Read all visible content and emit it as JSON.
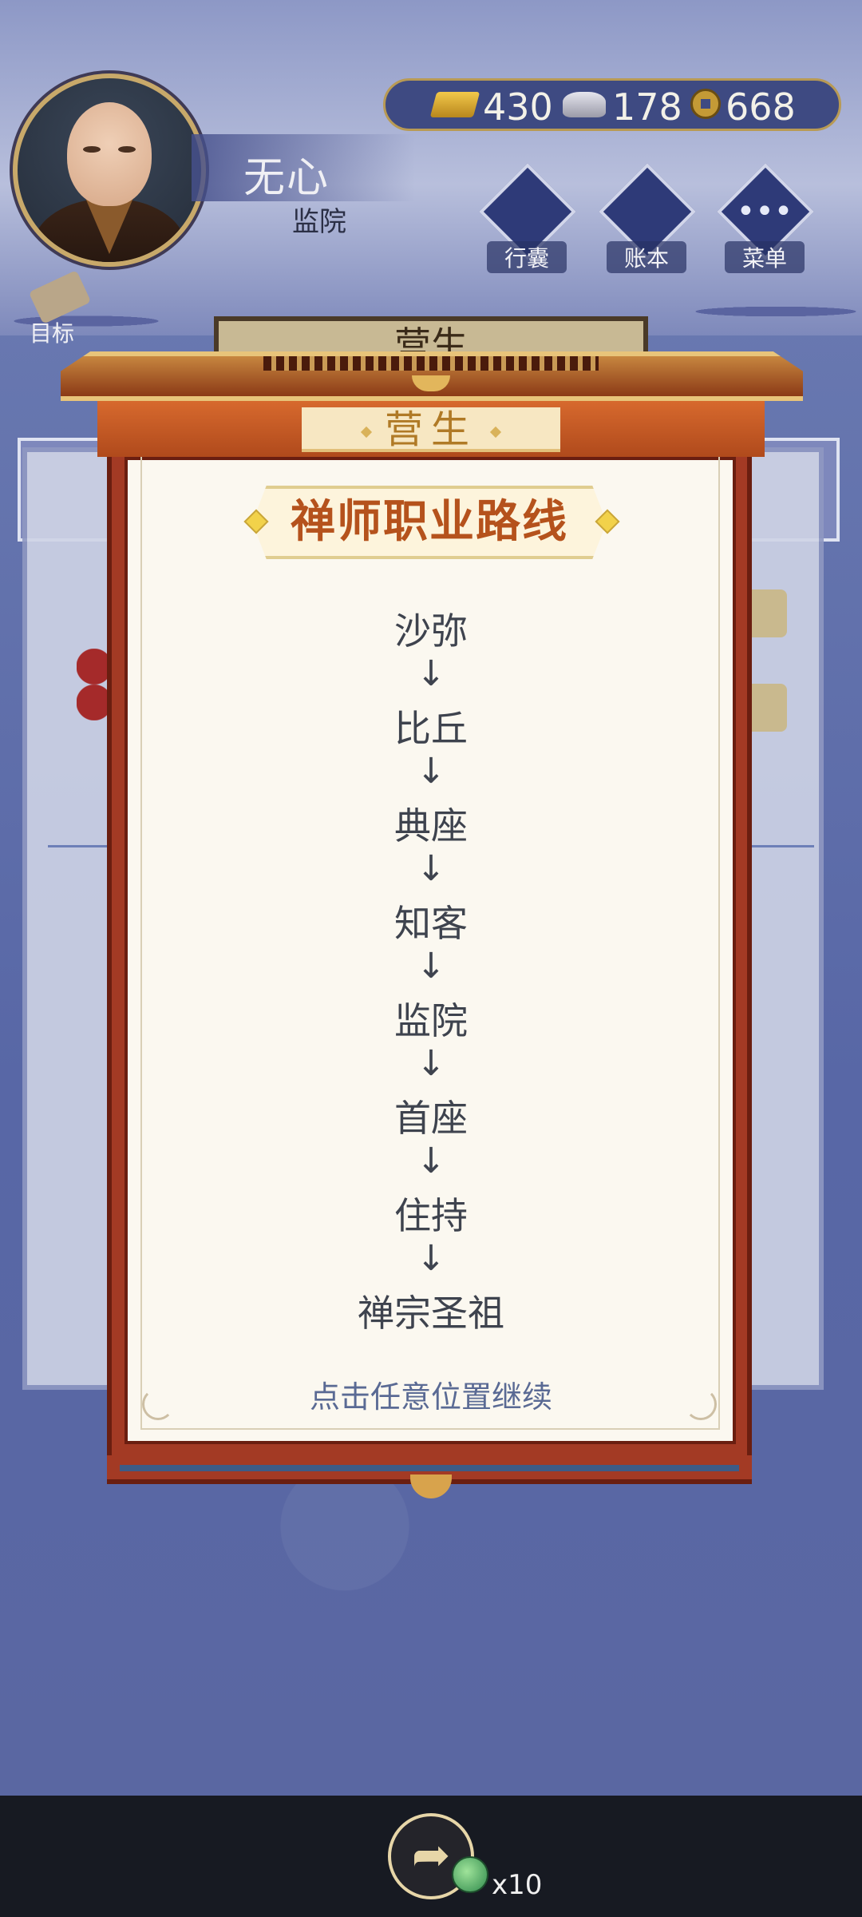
{
  "hud": {
    "player_name": "无心",
    "player_rank": "监院",
    "currency": {
      "gold": "430",
      "silver": "178",
      "coins": "668"
    },
    "buttons": {
      "bag": "行囊",
      "ledger": "账本",
      "menu": "菜单"
    },
    "goal_label": "目标",
    "menu_glyph": "•••"
  },
  "background_panel": {
    "title": "营生"
  },
  "modal": {
    "header_title": "营生",
    "title": "禅师职业路线",
    "path": [
      "沙弥",
      "比丘",
      "典座",
      "知客",
      "监院",
      "首座",
      "住持",
      "禅宗圣祖"
    ],
    "arrow": "↓",
    "continue_hint": "点击任意位置继续"
  },
  "bottom": {
    "share_glyph": "➦",
    "gem_count": "x10"
  }
}
